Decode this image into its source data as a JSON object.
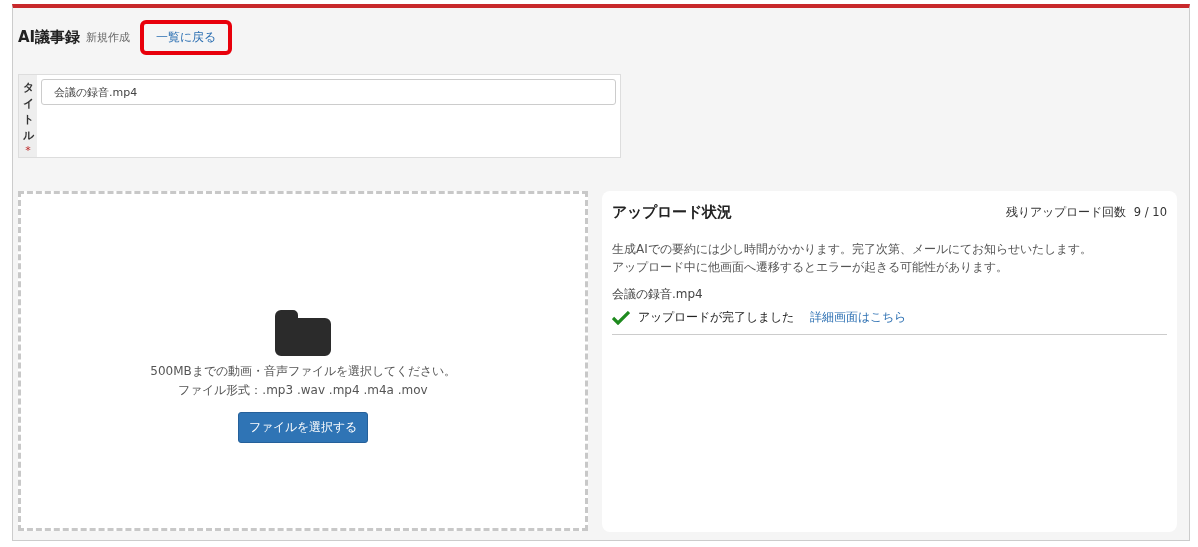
{
  "header": {
    "title": "AI議事録",
    "subtitle": "新規作成",
    "back_link": {
      "label": "一覧に戻る",
      "highlighted": true
    }
  },
  "title_field": {
    "label": "タイトル",
    "required": true,
    "required_mark": "*",
    "value": "会議の録音.mp4"
  },
  "dropzone": {
    "lines": [
      "500MBまでの動画・音声ファイルを選択してください。",
      "ファイル形式：.mp3 .wav .mp4 .m4a .mov"
    ],
    "button": "ファイルを選択する"
  },
  "upload_status": {
    "title": "アップロード状況",
    "remaining_label": "残りアップロード回数",
    "remaining_value": "9 / 10",
    "notes": [
      "生成AIでの要約には少し時間がかかります。完了次第、メールにてお知らせいたします。",
      "アップロード中に他画面へ遷移するとエラーが起きる可能性があります。"
    ],
    "files": [
      {
        "name": "会議の録音.mp4",
        "status": "アップロードが完了しました",
        "completed": true,
        "link": "詳細画面はこちら"
      }
    ]
  }
}
